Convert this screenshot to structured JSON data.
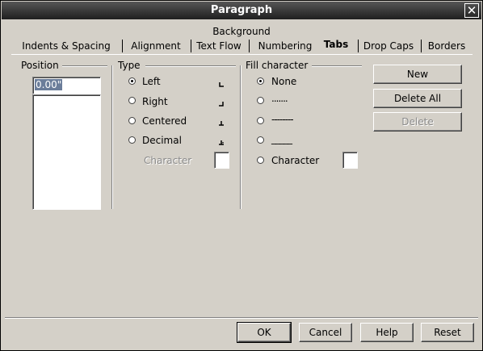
{
  "window": {
    "title": "Paragraph"
  },
  "tabs": {
    "back_row": [
      "Background"
    ],
    "front_row": [
      "Indents & Spacing",
      "Alignment",
      "Text Flow",
      "Numbering",
      "Tabs",
      "Drop Caps",
      "Borders"
    ],
    "active": "Tabs"
  },
  "position": {
    "label": "Position",
    "value": "0.00\""
  },
  "type": {
    "label": "Type",
    "options": [
      "Left",
      "Right",
      "Centered",
      "Decimal"
    ],
    "selected": "Left",
    "character_label": "Character"
  },
  "fill": {
    "label": "Fill character",
    "options": [
      "None",
      ".......",
      "--------",
      "_____",
      "Character"
    ],
    "selected": "None"
  },
  "side_buttons": {
    "new": "New",
    "delete_all": "Delete All",
    "delete": "Delete"
  },
  "footer": {
    "ok": "OK",
    "cancel": "Cancel",
    "help": "Help",
    "reset": "Reset"
  }
}
